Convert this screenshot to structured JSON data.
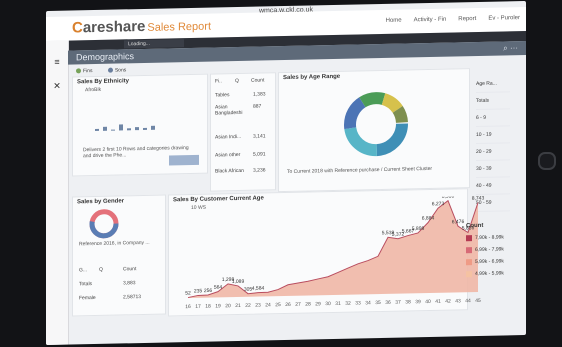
{
  "browser": {
    "url": "wmca.w.ckl.co.uk"
  },
  "app": {
    "logo_prefix": "C",
    "logo_main": "areshare",
    "logo_sub": "Sales Report"
  },
  "topnav": [
    "Home",
    "Activity - Fin",
    "Report",
    "Ev - Puroler"
  ],
  "tab": {
    "label": "Loading..."
  },
  "sheet": {
    "title": "Demographics"
  },
  "legend_top": {
    "item1": "Fins",
    "item2": "Sons"
  },
  "ethnicity": {
    "title": "Sales By Ethnicity",
    "headers": [
      "Fi..",
      "Q",
      "Count"
    ],
    "rows": [
      {
        "label": "Tables",
        "value": "1,383"
      },
      {
        "label": "Asian Bangladeshi",
        "value": "887"
      },
      {
        "label": "Asian Indi...",
        "value": "3,141"
      },
      {
        "label": "Asian other",
        "value": "5,091"
      },
      {
        "label": "Black African",
        "value": "3,236"
      }
    ],
    "note": "Delivers 2 first 10 Rows and categories drawing and drive the Phe..."
  },
  "age_range": {
    "title": "Sales by Age Range",
    "note": "To Current 2018 with Reference purchase / Current Sheet Cluster",
    "ages": [
      "Age Ra...",
      "Totals",
      "6 - 9",
      "10 - 19",
      "20 - 29",
      "30 - 39",
      "40 - 49",
      "50 - 59"
    ]
  },
  "gender": {
    "title": "Sales by Gender",
    "note": "Reference 2016, in Company ...",
    "filter_label": "Q",
    "headers": [
      "G...",
      "Q",
      "Count"
    ],
    "rows": [
      {
        "label": "Totals",
        "value": "3,883"
      },
      {
        "label": "Female",
        "value": "2,58713"
      }
    ]
  },
  "customer_age": {
    "title": "Sales By Customer Current Age",
    "ymax_label": "10 WS",
    "count_legend_title": "Count",
    "legend": [
      "7,90k - 8,99k",
      "6,99k - 7,99k",
      "5,99k - 6,99k",
      "4,99k - 5,99k"
    ],
    "x": [
      "16",
      "17",
      "18",
      "19",
      "20",
      "21",
      "22",
      "23",
      "24",
      "25",
      "26",
      "27",
      "28",
      "29",
      "30",
      "31",
      "32",
      "33",
      "34",
      "35",
      "36",
      "37",
      "38",
      "39",
      "40",
      "41",
      "42",
      "43",
      "44",
      "45"
    ],
    "values": [
      52,
      235,
      256,
      564,
      1298,
      1089,
      305,
      385,
      400,
      650,
      1100,
      1250,
      1400,
      1600,
      1800,
      2200,
      2600,
      3000,
      3300,
      3700,
      5538,
      5372,
      5667,
      5898,
      6884,
      8273,
      8986,
      6476,
      5836,
      8743
    ],
    "labels": [
      "52",
      "235",
      "256",
      "564",
      "1,298",
      "1,089",
      "305",
      "4,584",
      "5,538",
      "5,372",
      "5,667",
      "5,898",
      "6,884",
      "6,273",
      "8,986",
      "6,476",
      "5,836",
      "8,743"
    ]
  },
  "colors": {
    "accent": "#d9812e",
    "header": "#5e6a79",
    "blue": "#5a7db4"
  }
}
